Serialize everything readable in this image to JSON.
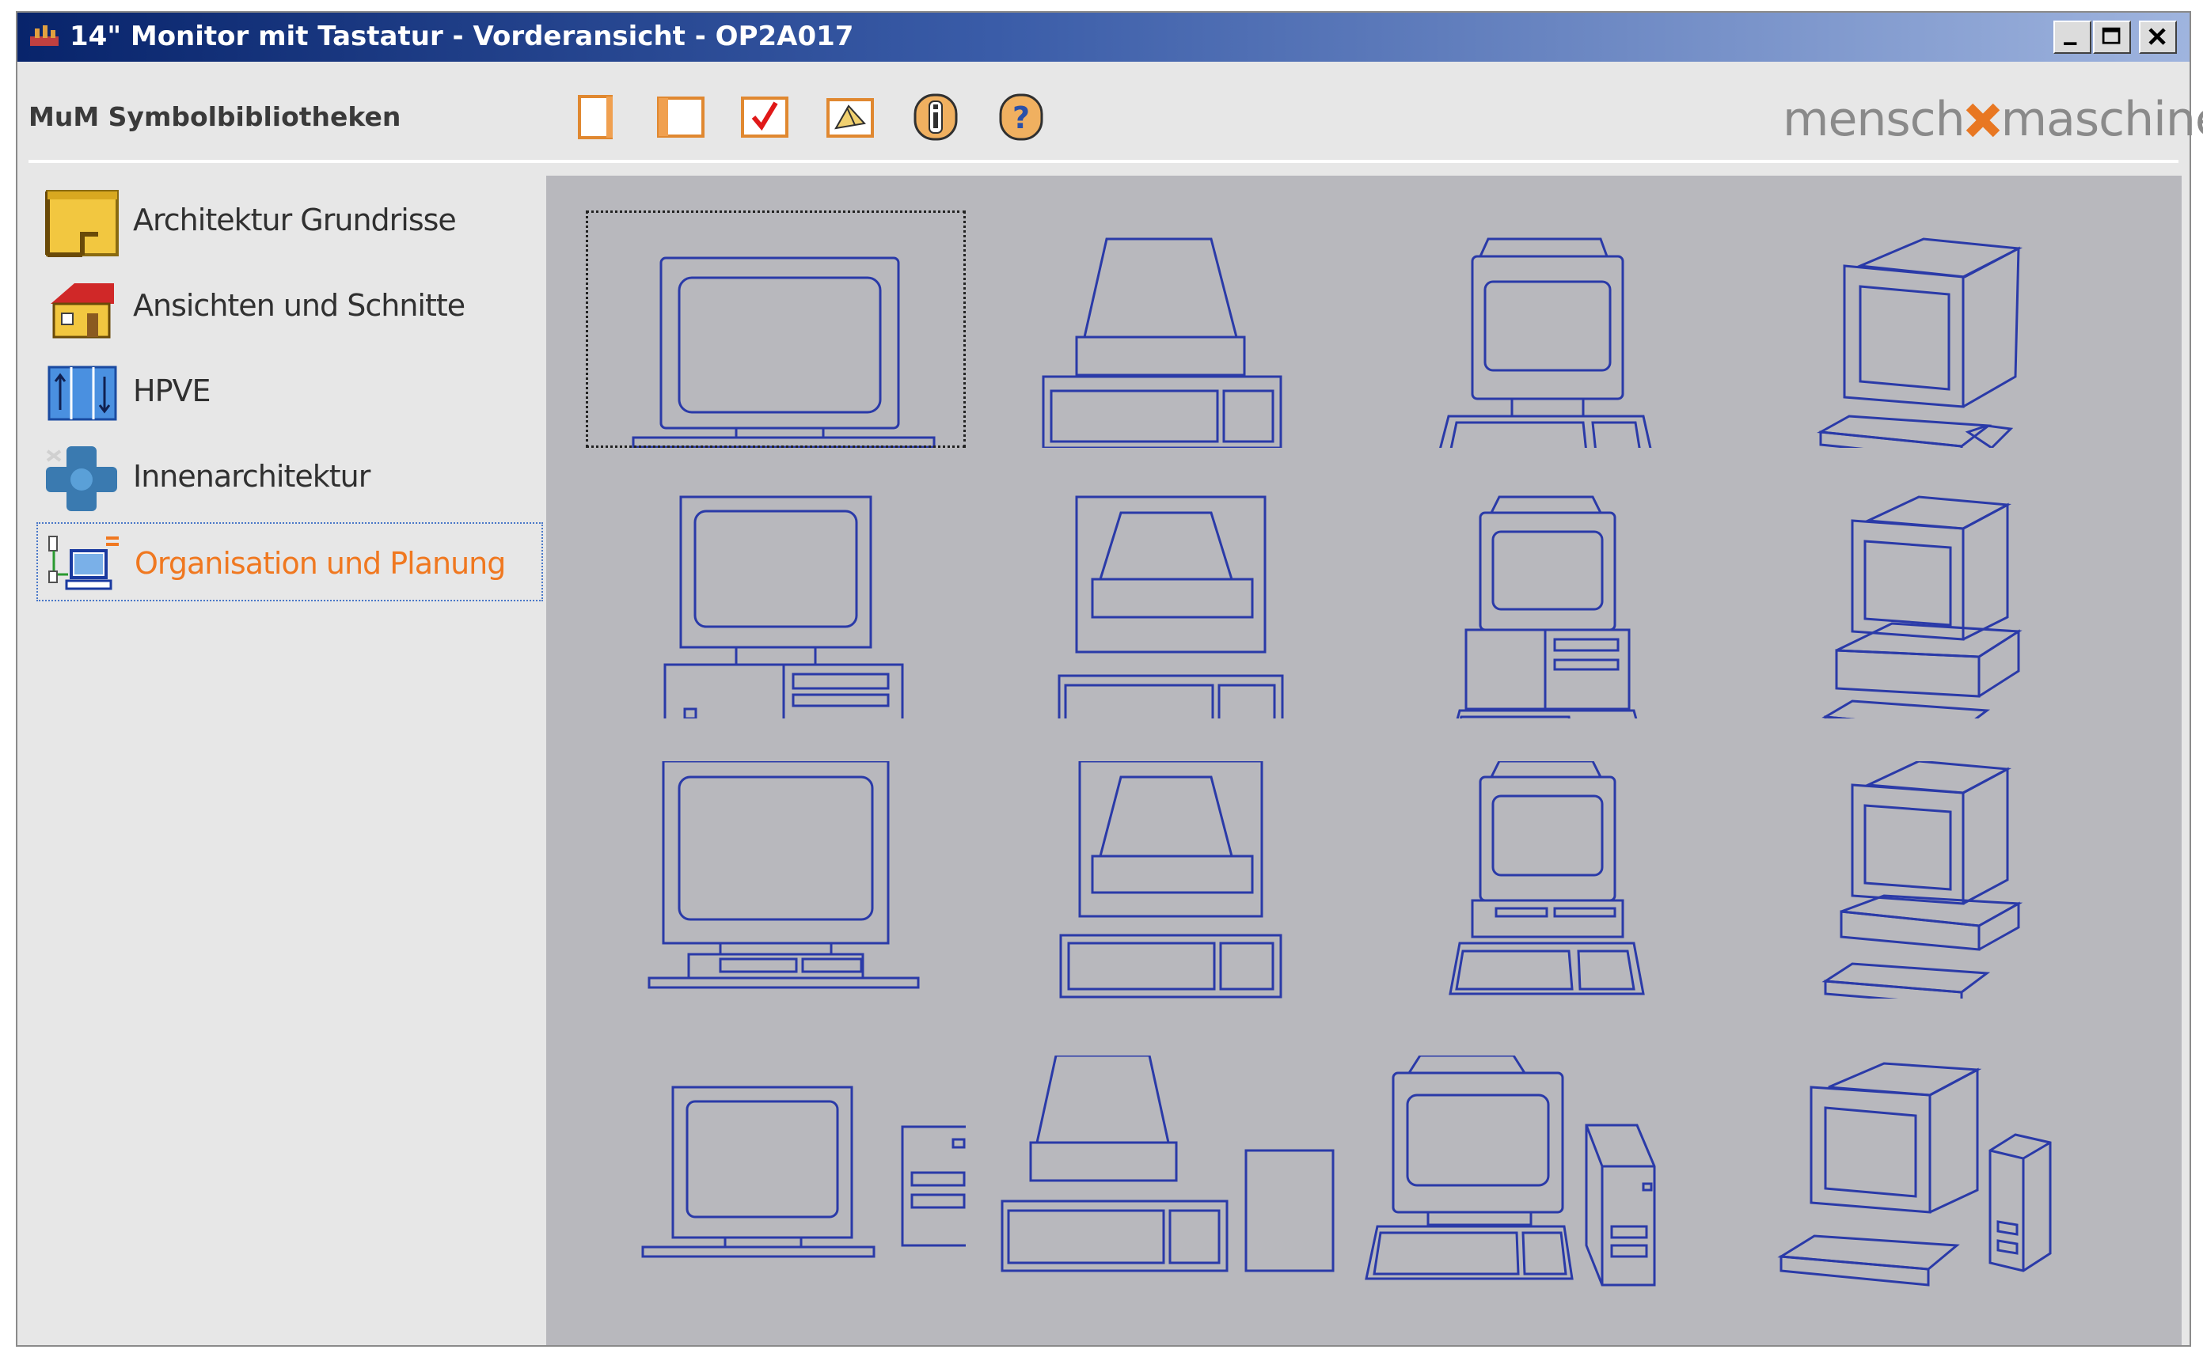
{
  "window": {
    "title": "14\" Monitor mit Tastatur - Vorderansicht - OP2A017",
    "app_icon": "app-icon",
    "controls": [
      "minimize-icon",
      "maximize-icon",
      "close-icon"
    ]
  },
  "header": {
    "title": "MuM Symbolbibliotheken",
    "toolbar": [
      {
        "name": "new-page-icon"
      },
      {
        "name": "open-book-icon"
      },
      {
        "name": "checkmark-icon"
      },
      {
        "name": "insert-symbol-icon"
      },
      {
        "name": "info-icon"
      },
      {
        "name": "help-icon"
      }
    ],
    "logo": {
      "left": "mensch",
      "right": "maschine"
    }
  },
  "sidebar": {
    "items": [
      {
        "label": "Architektur Grundrisse",
        "icon": "floorplan-icon",
        "active": false
      },
      {
        "label": "Ansichten und Schnitte",
        "icon": "house-icon",
        "active": false
      },
      {
        "label": "HPVE",
        "icon": "hpve-icon",
        "active": false
      },
      {
        "label": "Innenarchitektur",
        "icon": "interior-icon",
        "active": false
      },
      {
        "label": "Organisation und Planung",
        "icon": "computer-icon",
        "active": true
      }
    ]
  },
  "symbols": {
    "selected_index": 0,
    "items": [
      "monitor-icon",
      "terminal-icon",
      "monitor-keyboard-icon",
      "monitor-keyboard-iso-icon",
      "desktop-pc-icon",
      "terminal-cabinet-icon",
      "workstation-icon",
      "workstation-iso-icon",
      "large-monitor-icon",
      "terminal-cabinet-2-icon",
      "workstation-2-icon",
      "workstation-iso-2-icon",
      "pc-tower-icon",
      "terminal-tower-icon",
      "workstation-tower-icon",
      "workstation-tower-iso-icon"
    ]
  },
  "colors": {
    "title_bar": "#08246b",
    "panel": "#b8b8bd",
    "symbol_stroke": "#2a3aa8",
    "active_item": "#f07820",
    "logo_accent": "#e87722"
  }
}
